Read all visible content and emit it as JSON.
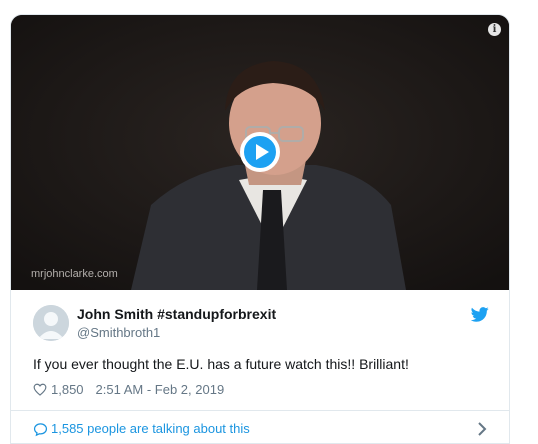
{
  "video": {
    "watermark": "mrjohnclarke.com",
    "info_icon": "info-icon",
    "play_icon": "play-icon"
  },
  "author": {
    "display_name": "John Smith #standupforbrexit",
    "handle": "@Smithbroth1",
    "avatar_icon": "avatar-placeholder-icon",
    "brand_icon": "twitter-bird-icon"
  },
  "tweet": {
    "text": "If you ever thought the E.U. has a future watch this!! Brilliant!",
    "likes": "1,850",
    "timestamp": "2:51 AM - Feb 2, 2019"
  },
  "footer": {
    "talking": "1,585 people are talking about this"
  },
  "colors": {
    "accent": "#1da1f2",
    "link": "#1b95e0",
    "secondary_text": "#657786",
    "border": "#e1e8ed"
  }
}
